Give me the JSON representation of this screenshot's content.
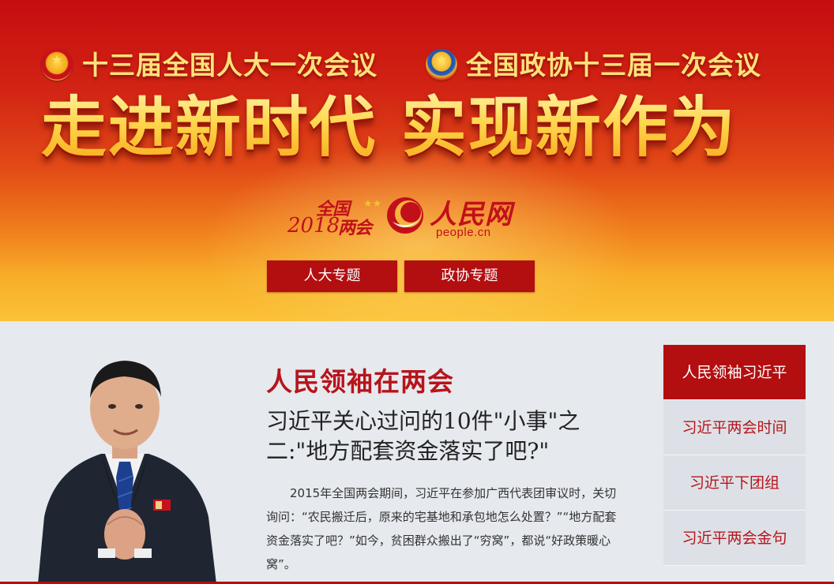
{
  "banner": {
    "npc_session": "十三届全国人大一次会议",
    "cppcc_session": "全国政协十三届一次会议",
    "slogan": "走进新时代 实现新作为",
    "logo": {
      "event_top": "全国",
      "event_year": "2018",
      "event_bottom": "两会",
      "site_name": "人民网",
      "site_domain": "people.cn"
    },
    "buttons": {
      "npc_topic": "人大专题",
      "cppcc_topic": "政协专题"
    }
  },
  "main": {
    "section_title": "人民领袖在两会",
    "headline": "习近平关心过问的10件\"小事\"之二:\"地方配套资金落实了吧?\"",
    "summary": "2015年全国两会期间，习近平在参加广西代表团审议时，关切询问：“农民搬迁后，原来的宅基地和承包地怎么处置？”“地方配套资金落实了吧？”如今，贫困群众搬出了“穷窝”，都说“好政策暖心窝”。"
  },
  "side_nav": {
    "items": [
      {
        "label": "人民领袖习近平",
        "active": true
      },
      {
        "label": "习近平两会时间",
        "active": false
      },
      {
        "label": "习近平下团组",
        "active": false
      },
      {
        "label": "习近平两会金句",
        "active": false
      }
    ]
  },
  "colors": {
    "brand_red": "#b30e10",
    "title_red": "#b7141b",
    "gold": "#ffd24a",
    "content_bg": "#e6e9ee"
  },
  "icons": [
    "national-emblem-icon",
    "cppcc-emblem-icon",
    "people-daily-logo-icon"
  ]
}
